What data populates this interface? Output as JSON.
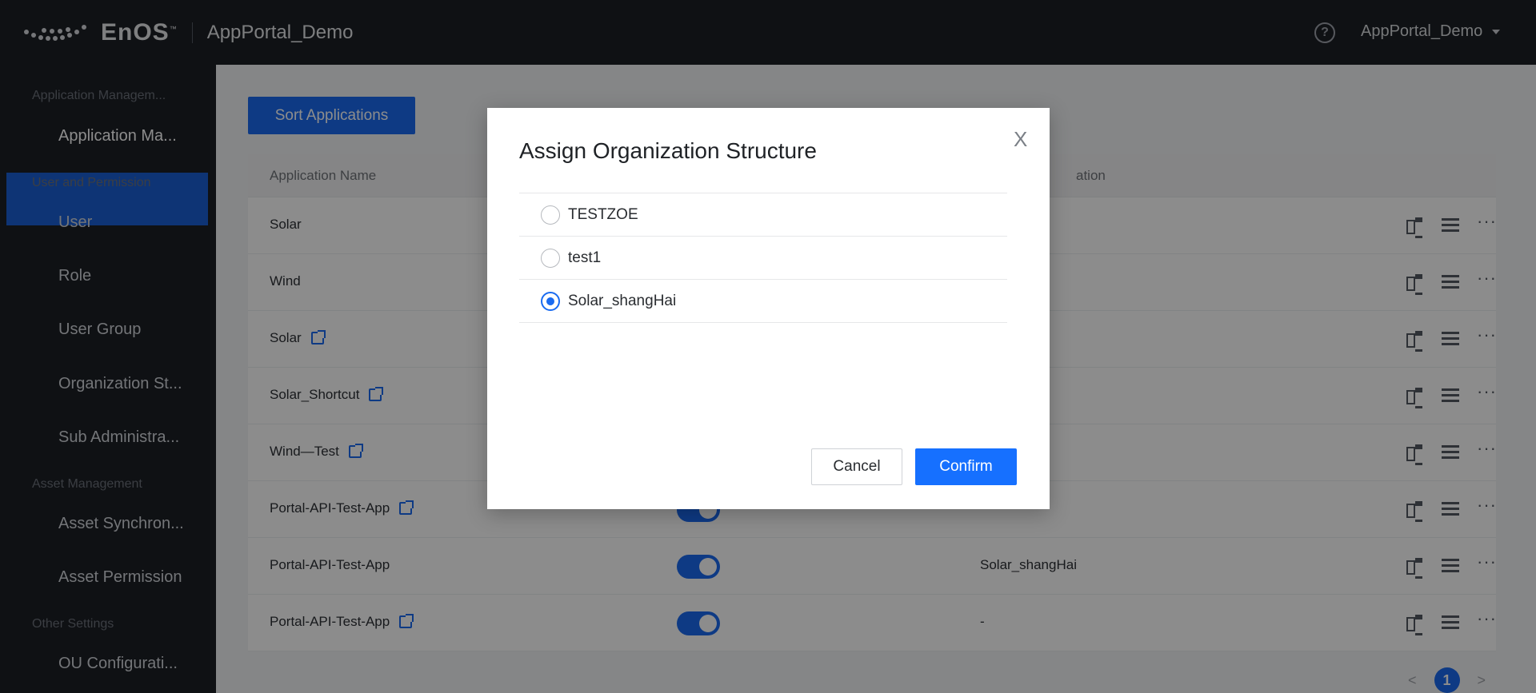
{
  "topbar": {
    "brand": "EnOS",
    "trademark": "™",
    "app_title": "AppPortal_Demo",
    "user_menu_label": "AppPortal_Demo"
  },
  "sidebar": {
    "groups": [
      {
        "label": "Application Managem...",
        "items": [
          {
            "label": "Application Ma..."
          }
        ]
      },
      {
        "label": "User and Permission",
        "items": [
          {
            "label": "User"
          },
          {
            "label": "Role"
          },
          {
            "label": "User Group"
          },
          {
            "label": "Organization St..."
          },
          {
            "label": "Sub Administra..."
          }
        ]
      },
      {
        "label": "Asset Management",
        "items": [
          {
            "label": "Asset Synchron..."
          },
          {
            "label": "Asset Permission"
          }
        ]
      },
      {
        "label": "Other Settings",
        "items": [
          {
            "label": "OU Configurati..."
          }
        ]
      }
    ]
  },
  "main": {
    "sort_button_label": "Sort Applications",
    "table": {
      "headers": {
        "name": "Application Name",
        "org": "ation"
      },
      "rows": [
        {
          "name": "Solar",
          "external": false,
          "org": ""
        },
        {
          "name": "Wind",
          "external": false,
          "org": ""
        },
        {
          "name": "Solar",
          "external": true,
          "org": ""
        },
        {
          "name": "Solar_Shortcut",
          "external": true,
          "org": ""
        },
        {
          "name": "Wind—Test",
          "external": true,
          "org": ""
        },
        {
          "name": "Portal-API-Test-App",
          "external": true,
          "org": "-"
        },
        {
          "name": "Portal-API-Test-App",
          "external": false,
          "org": "Solar_shangHai"
        },
        {
          "name": "Portal-API-Test-App",
          "external": true,
          "org": "-"
        }
      ]
    },
    "pagination": {
      "prev": "<",
      "current": "1",
      "next": ">"
    }
  },
  "modal": {
    "title": "Assign Organization Structure",
    "close": "X",
    "options": [
      {
        "label": "TESTZOE",
        "checked": false
      },
      {
        "label": "test1",
        "checked": false
      },
      {
        "label": "Solar_shangHai",
        "checked": true
      }
    ],
    "cancel_label": "Cancel",
    "confirm_label": "Confirm"
  },
  "colors": {
    "accent": "#1a6bf0",
    "sidebar_bg": "#1c1f26",
    "active_item": "#1b5fd6"
  }
}
